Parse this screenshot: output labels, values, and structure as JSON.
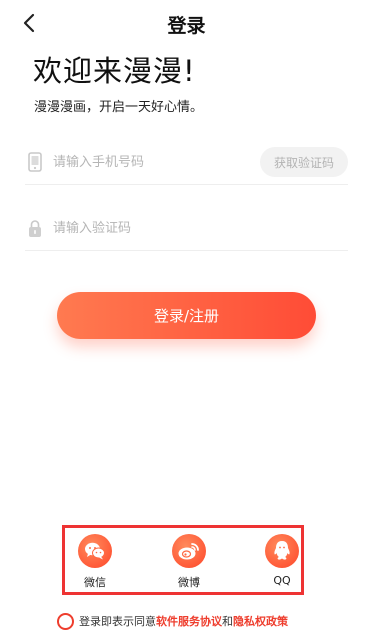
{
  "header": {
    "title": "登录"
  },
  "welcome": {
    "heading": "欢迎来漫漫!",
    "subtitle": "漫漫漫画，开启一天好心情。"
  },
  "phone": {
    "placeholder": "请输入手机号码",
    "value": "",
    "icon": "phone-icon"
  },
  "get_code": {
    "label": "获取验证码"
  },
  "code": {
    "placeholder": "请输入验证码",
    "value": "",
    "icon": "lock-icon"
  },
  "login_button": {
    "label": "登录/注册"
  },
  "social": [
    {
      "label": "微信",
      "icon": "wechat-icon"
    },
    {
      "label": "微博",
      "icon": "weibo-icon"
    },
    {
      "label": "QQ",
      "icon": "qq-icon"
    }
  ],
  "agreement": {
    "prefix": "登录即表示同意",
    "terms": "软件服务协议",
    "and": "和",
    "privacy": "隐私权政策",
    "checked": false
  },
  "colors": {
    "accent": "#ff5a3c",
    "accent_light": "#ff7a50",
    "highlight_border": "#ee3333"
  }
}
